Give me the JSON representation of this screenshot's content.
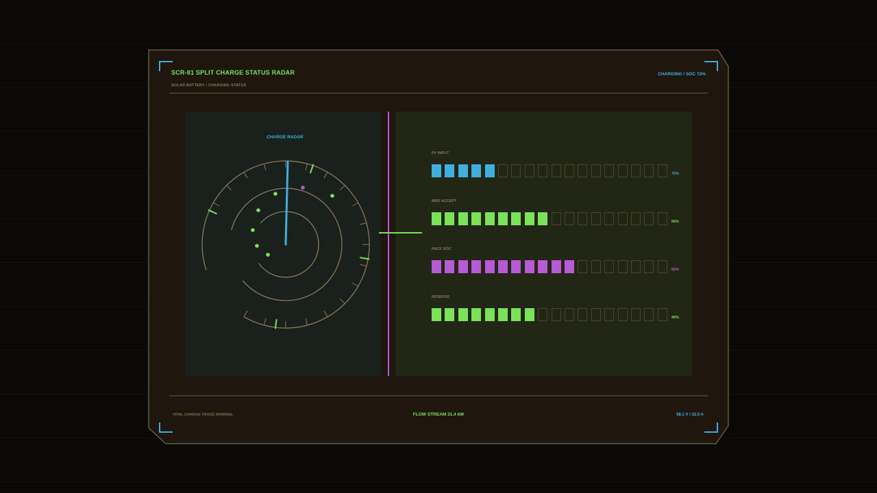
{
  "header": {
    "title": "SCR-81  SPLIT CHARGE STATUS RADAR",
    "subtitle": "SOLAR BATTERY / CHARGING STATUS",
    "status": "CHARGING  /  SOC 72%"
  },
  "radar": {
    "title": "CHARGE RADAR",
    "sweep_color": "#3fb0dd",
    "blip_color": "#7be35a",
    "marker_color": "#b75ad6"
  },
  "bars": [
    {
      "label": "PV INPUT",
      "value": "75%",
      "filled": 5,
      "total": 18,
      "color": "#3fb0dd"
    },
    {
      "label": "BMS ACCEPT",
      "value": "65%",
      "filled": 9,
      "total": 18,
      "color": "#7be35a"
    },
    {
      "label": "PACK SOC",
      "value": "55%",
      "filled": 11,
      "total": 18,
      "color": "#b75ad6"
    },
    {
      "label": "RESERVE",
      "value": "40%",
      "filled": 8,
      "total": 18,
      "color": "#7be35a"
    }
  ],
  "footer": {
    "left": "VITAL CHARGE TRACE NOMINAL",
    "center": "FLOW STREAM 31.4 kW",
    "right": "58.1 V / 32.0 A"
  },
  "colors": {
    "frame": "#8b7a5b",
    "accent_blue": "#3fb0dd",
    "accent_green": "#7be35a",
    "accent_purple": "#b75ad6"
  }
}
